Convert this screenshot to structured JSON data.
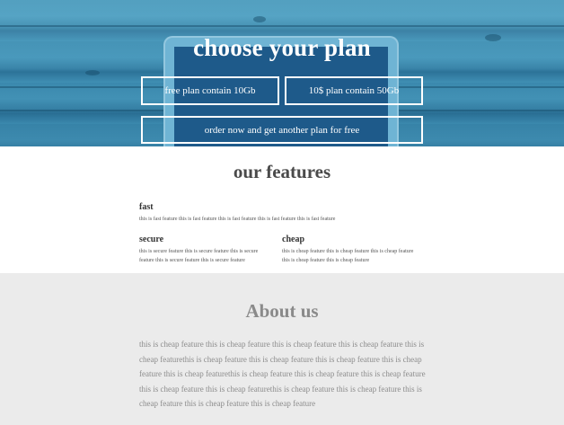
{
  "hero": {
    "title": "choose your plan",
    "buttons": {
      "free": "free plan contain 10Gb",
      "ten": "10$ plan contain 50Gb",
      "order": "order now and get another plan for free"
    }
  },
  "features": {
    "title": "our features",
    "items": [
      {
        "heading": "fast",
        "text": "this is fast feature this is fast feature this is fast feature this is fast feature this is fast feature"
      },
      {
        "heading": "secure",
        "text": "this is secure feature this is secure feature this is secure feature this is secure feature this is secure feature"
      },
      {
        "heading": "cheap",
        "text": "this is cheap feature this is cheap feature this is cheap feature this is cheap feature this is cheap feature"
      }
    ]
  },
  "about": {
    "title": "About us",
    "text": "this is cheap feature this is cheap feature this is cheap feature this is cheap feature this is cheap featurethis is cheap feature this is cheap feature this is cheap feature this is cheap feature this is cheap featurethis is cheap feature this is cheap feature this is cheap feature this is cheap feature this is cheap featurethis is cheap feature this is cheap feature this is cheap feature this is cheap feature this is cheap feature"
  },
  "colors": {
    "hero_bg": "#3f8fb3",
    "features_heading": "#4a4a4a",
    "about_bg": "#ebebeb",
    "about_text": "#8c8c8c"
  }
}
